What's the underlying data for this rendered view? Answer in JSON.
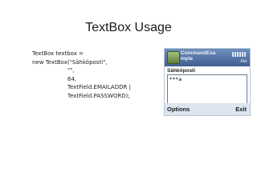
{
  "slide": {
    "title": "TextBox Usage"
  },
  "code": {
    "lines": [
      "TextBox textbox =",
      "new TextBox(\"Sähköposti\",",
      "\"\",",
      "64,",
      "TextField.EMAILADDR |",
      "TextField.PASSWORD);"
    ]
  },
  "phone": {
    "app_title": "CommandExa mple",
    "input_mode": "Abc",
    "textbox_label": "Sähköposti",
    "textbox_value": "***a",
    "left_softkey": "Options",
    "right_softkey": "Exit",
    "icons": {
      "app": "app-icon",
      "signal": "signal-icon"
    }
  }
}
